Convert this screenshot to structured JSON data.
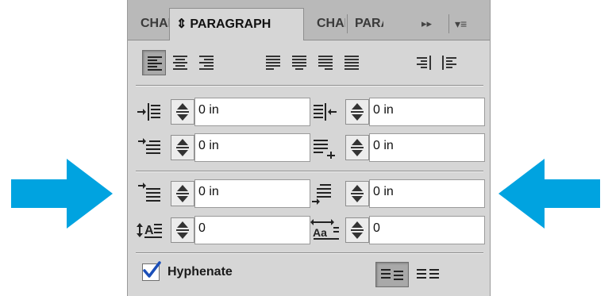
{
  "tabs": [
    {
      "label": "CHARACTER",
      "active": false
    },
    {
      "label": "PARAGRAPH",
      "active": true
    },
    {
      "label": "CHARACTER",
      "active": false
    },
    {
      "label": "PARAGRAPH",
      "active": false
    }
  ],
  "tab_updown_glyph": "⇕",
  "tabbar": {
    "expand_glyph": "▸▸",
    "menu_glyph": "▾≡"
  },
  "alignment_buttons": [
    {
      "name": "align-left",
      "active": true
    },
    {
      "name": "align-center",
      "active": false
    },
    {
      "name": "align-right",
      "active": false
    },
    {
      "name": "justify-last-left",
      "active": false
    },
    {
      "name": "justify-last-center",
      "active": false
    },
    {
      "name": "justify-last-right",
      "active": false
    },
    {
      "name": "justify-all",
      "active": false
    },
    {
      "name": "align-toward-spine",
      "active": false
    },
    {
      "name": "align-away-from-spine",
      "active": false
    }
  ],
  "indents": {
    "left_indent": "0 in",
    "right_indent": "0 in",
    "first_line_indent": "0 in",
    "last_line_indent": "0 in"
  },
  "spacing": {
    "space_before": "0 in",
    "space_after": "0 in"
  },
  "drop_cap": {
    "number_of_lines": "0",
    "number_of_characters": "0",
    "lines_icon_text": "A",
    "chars_icon_text": "Aa"
  },
  "hyphenate": {
    "label": "Hyphenate",
    "checked": true
  },
  "colors": {
    "arrow": "#00a3e0",
    "panel": "#d6d6d6",
    "tabbar": "#b9b9b9",
    "check": "#1b4fb8"
  },
  "icons": {
    "arrows": "arrow-right-icon, arrow-left-icon",
    "grid": "do-not-align-to-baseline-grid-icon, align-to-baseline-grid-icon"
  }
}
